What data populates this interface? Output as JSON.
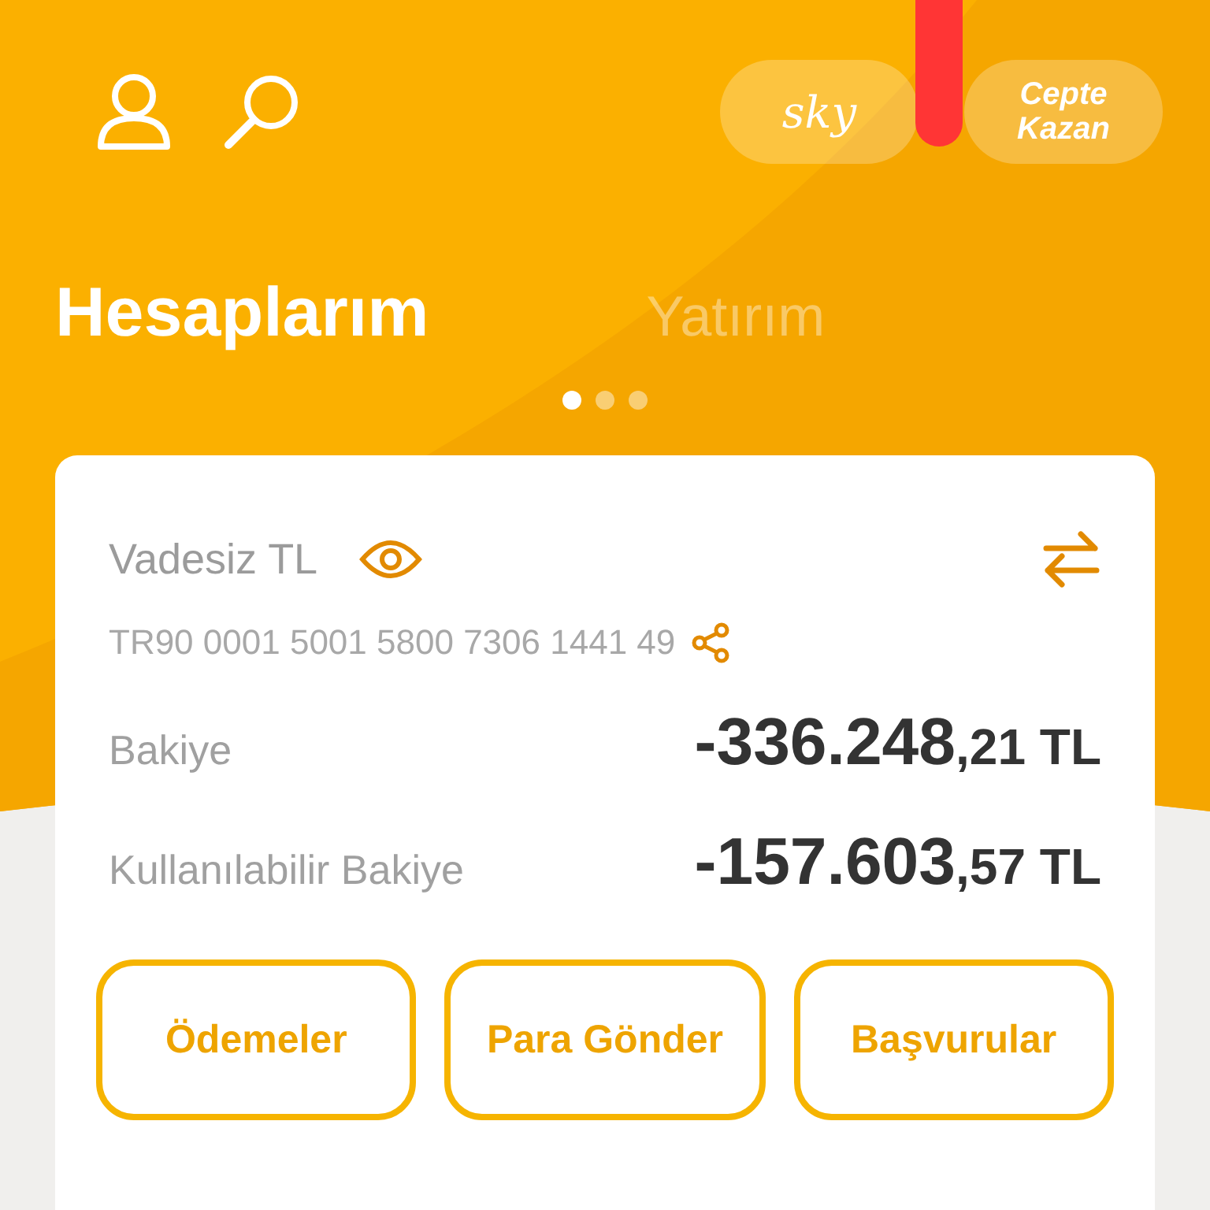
{
  "header": {
    "promo_buttons": [
      {
        "label": "sky",
        "kind": "logo"
      },
      {
        "label": "Cepte\nKazan",
        "kind": "text"
      }
    ]
  },
  "tabs": [
    {
      "label": "Hesaplarım",
      "selected": true
    },
    {
      "label": "Yatırım",
      "selected": false
    }
  ],
  "pager": [
    {
      "selected": true
    },
    {
      "selected": false
    },
    {
      "selected": false
    }
  ],
  "account": {
    "name": "Vadesiz TL",
    "iban": "TR90 0001 5001 5800 7306 1441 49",
    "balances": [
      {
        "label": "Bakiye",
        "whole": "-336.248",
        "fraction": ",21 TL"
      },
      {
        "label": "Kullanılabilir Bakiye",
        "whole": "-157.603",
        "fraction": ",57 TL"
      }
    ],
    "actions": [
      "Ödemeler",
      "Para Gönder",
      "Başvurular"
    ]
  }
}
